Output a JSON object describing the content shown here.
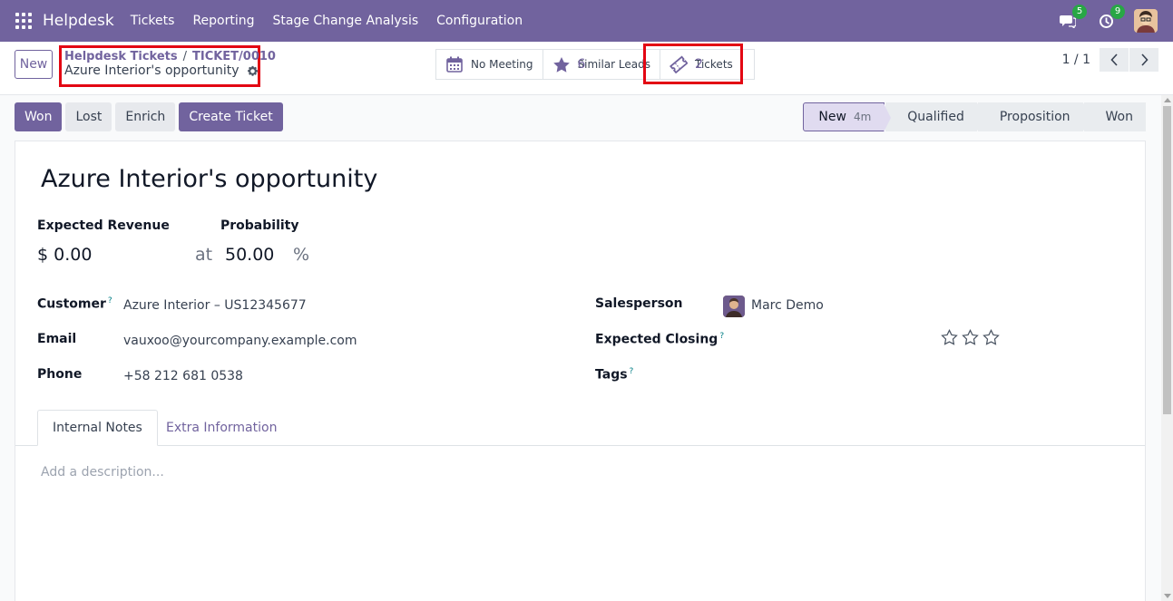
{
  "navbar": {
    "brand": "Helpdesk",
    "menu": [
      "Tickets",
      "Reporting",
      "Stage Change Analysis",
      "Configuration"
    ],
    "messages_badge": "5",
    "activities_badge": "9",
    "icons": [
      "apps-grid-icon",
      "chat-icon",
      "clock-icon",
      "user-avatar"
    ]
  },
  "control": {
    "new_label": "New",
    "breadcrumb_parent": "Helpdesk Tickets",
    "breadcrumb_sep": "/",
    "breadcrumb_current": "TICKET/0010",
    "record_name": "Azure Interior's opportunity",
    "smart_buttons": {
      "meeting": "No Meeting",
      "similar_label": "Similar Leads",
      "similar_value": "6",
      "tickets_label": "Tickets",
      "tickets_value": "2"
    },
    "pager": "1 / 1"
  },
  "actions": [
    "Won",
    "Lost",
    "Enrich",
    "Create Ticket"
  ],
  "stages": {
    "items": [
      "New",
      "Qualified",
      "Proposition",
      "Won"
    ],
    "current_duration": "4m"
  },
  "form": {
    "title": "Azure Interior's opportunity",
    "expected_revenue_label": "Expected Revenue",
    "expected_revenue": "$ 0.00",
    "at": "at",
    "probability_label": "Probability",
    "probability": "50.00",
    "percent": "%",
    "customer_label": "Customer",
    "customer": "Azure Interior – US12345677",
    "email_label": "Email",
    "email": "vauxoo@yourcompany.example.com",
    "phone_label": "Phone",
    "phone": "+58 212 681 0538",
    "salesperson_label": "Salesperson",
    "salesperson": "Marc Demo",
    "expected_closing_label": "Expected Closing",
    "tags_label": "Tags",
    "help_mark": "?",
    "priority_stars": 0
  },
  "tabs": [
    "Internal Notes",
    "Extra Information"
  ],
  "description_placeholder": "Add a description...",
  "colors": {
    "brand": "#71639e",
    "highlight": "#e30613",
    "badge": "#28a745"
  }
}
